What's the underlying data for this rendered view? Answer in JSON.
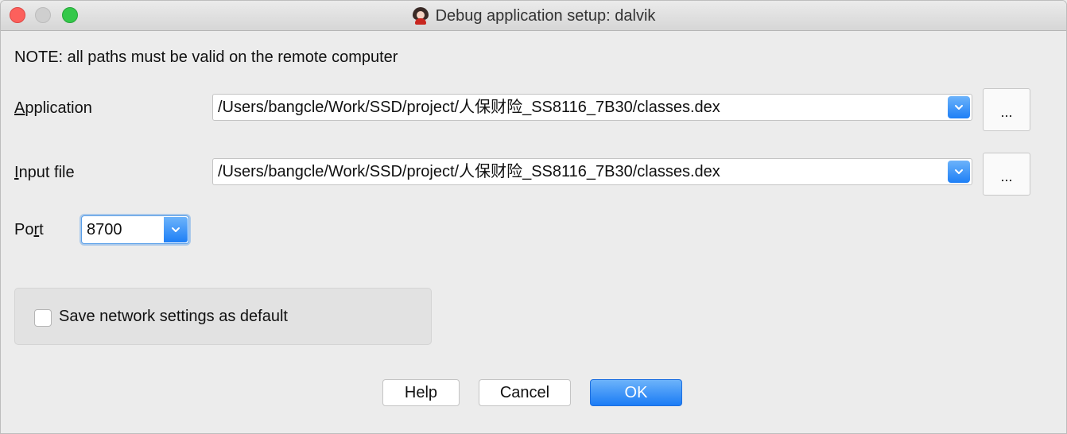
{
  "window": {
    "title": "Debug application setup: dalvik",
    "app_icon": "dalvik-debugger-icon"
  },
  "note": "NOTE: all paths must be valid on the remote computer",
  "application": {
    "label_mnemonic": "A",
    "label_rest": "pplication",
    "value": "/Users/bangcle/Work/SSD/project/人保财险_SS8116_7B30/classes.dex",
    "browse_label": "..."
  },
  "input_file": {
    "label_mnemonic": "I",
    "label_rest": "nput file",
    "value": "/Users/bangcle/Work/SSD/project/人保财险_SS8116_7B30/classes.dex",
    "browse_label": "..."
  },
  "port": {
    "label_pre": "Po",
    "label_mnemonic": "r",
    "label_post": "t",
    "value": "8700"
  },
  "save_settings": {
    "label": "Save network settings as default",
    "checked": false
  },
  "buttons": {
    "help": "Help",
    "cancel": "Cancel",
    "ok": "OK"
  },
  "colors": {
    "accent": "#1e7ff6",
    "close": "#fc605c",
    "zoom": "#34c84a"
  }
}
